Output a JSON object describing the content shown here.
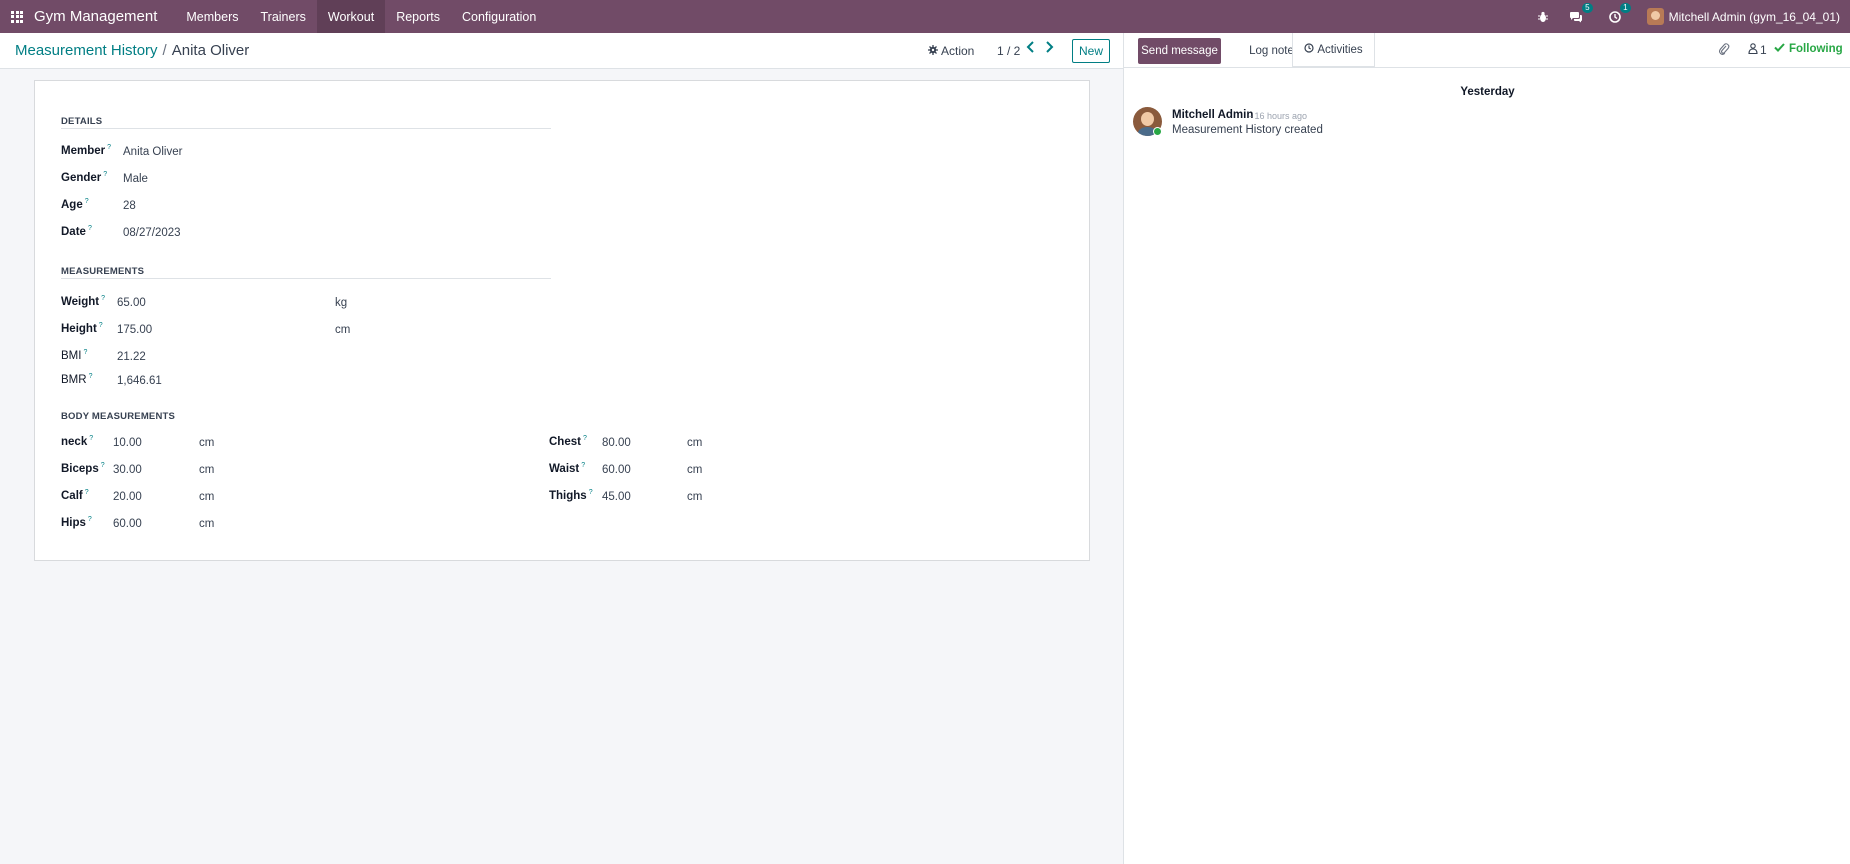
{
  "navbar": {
    "brand": "Gym Management",
    "menu": [
      "Members",
      "Trainers",
      "Workout",
      "Reports",
      "Configuration"
    ],
    "active_menu": "Workout",
    "messages_count": "5",
    "activities_count": "1",
    "user": "Mitchell Admin (gym_16_04_01)"
  },
  "control": {
    "breadcrumb_parent": "Measurement History",
    "breadcrumb_sep": "/",
    "breadcrumb_current": "Anita Oliver",
    "action_label": "Action",
    "pager": "1 / 2",
    "new_label": "New"
  },
  "form": {
    "details": {
      "title": "DETAILS",
      "member_label": "Member",
      "member_value": "Anita Oliver",
      "gender_label": "Gender",
      "gender_value": "Male",
      "age_label": "Age",
      "age_value": "28",
      "date_label": "Date",
      "date_value": "08/27/2023"
    },
    "measurements": {
      "title": "MEASUREMENTS",
      "weight_label": "Weight",
      "weight_value": "65.00",
      "weight_unit": "kg",
      "height_label": "Height",
      "height_value": "175.00",
      "height_unit": "cm",
      "bmi_label": "BMI",
      "bmi_value": "21.22",
      "bmr_label": "BMR",
      "bmr_value": "1,646.61"
    },
    "body": {
      "title": "BODY MEASUREMENTS",
      "neck_label": "neck",
      "neck_value": "10.00",
      "neck_unit": "cm",
      "biceps_label": "Biceps",
      "biceps_value": "30.00",
      "biceps_unit": "cm",
      "calf_label": "Calf",
      "calf_value": "20.00",
      "calf_unit": "cm",
      "hips_label": "Hips",
      "hips_value": "60.00",
      "hips_unit": "cm",
      "chest_label": "Chest",
      "chest_value": "80.00",
      "chest_unit": "cm",
      "waist_label": "Waist",
      "waist_value": "60.00",
      "waist_unit": "cm",
      "thighs_label": "Thighs",
      "thighs_value": "45.00",
      "thighs_unit": "cm"
    },
    "help_mark": "?"
  },
  "chatter": {
    "send_message": "Send message",
    "log_note": "Log note",
    "activities": "Activities",
    "followers_count": "1",
    "following": "Following",
    "date_separator": "Yesterday",
    "message": {
      "author": "Mitchell Admin",
      "time": "- 16 hours ago",
      "body": "Measurement History created"
    }
  },
  "colors": {
    "brand": "#714B67",
    "accent": "#017e84",
    "following": "#28a745"
  }
}
